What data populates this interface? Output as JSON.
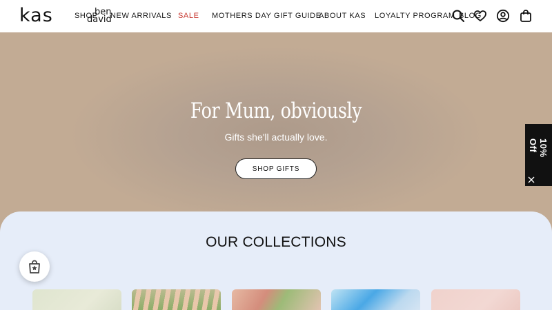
{
  "header": {
    "logo": "kas",
    "partner_logo_line1": "ben",
    "partner_logo_line2": "david",
    "nav": [
      {
        "label": "SHOP"
      },
      {
        "label": "NEW ARRIVALS"
      },
      {
        "label": "SALE"
      },
      {
        "label": "MOTHERS DAY GIFT GUIDE"
      },
      {
        "label": "ABOUT KAS"
      },
      {
        "label": "LOYALTY PROGRAM"
      },
      {
        "label": "BLOG"
      }
    ],
    "icons": [
      "search-icon",
      "heart-icon",
      "account-icon",
      "bag-icon"
    ],
    "sale_color": "#c7372f"
  },
  "hero": {
    "title": "For Mum, obviously",
    "subtitle": "Gifts she'll actually love.",
    "button": "SHOP GIFTS"
  },
  "promo": {
    "label": "10% Off"
  },
  "collections": {
    "title": "OUR COLLECTIONS"
  },
  "rewards": {
    "icon": "rewards-bag-icon"
  }
}
